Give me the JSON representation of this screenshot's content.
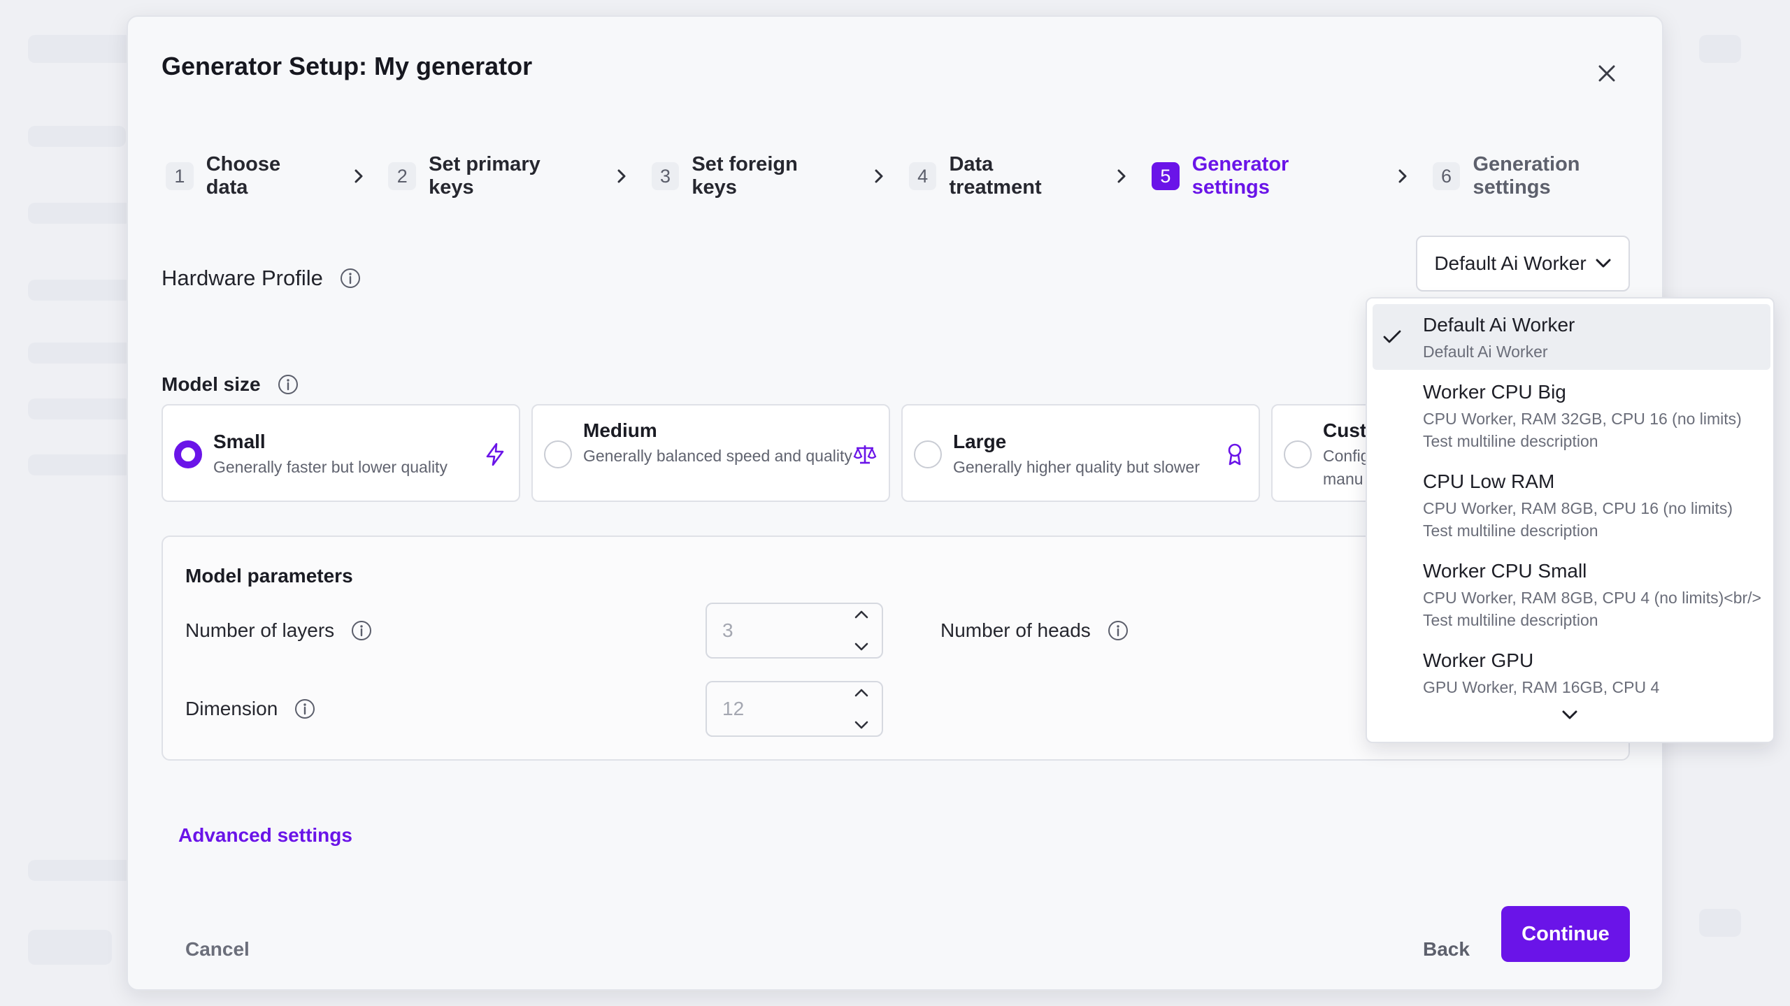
{
  "modal": {
    "title": "Generator Setup: My generator"
  },
  "stepper": [
    {
      "num": "1",
      "label": "Choose data"
    },
    {
      "num": "2",
      "label": "Set primary keys"
    },
    {
      "num": "3",
      "label": "Set foreign keys"
    },
    {
      "num": "4",
      "label": "Data treatment"
    },
    {
      "num": "5",
      "label": "Generator settings"
    },
    {
      "num": "6",
      "label": "Generation settings"
    }
  ],
  "hardware": {
    "label": "Hardware Profile",
    "selected": "Default Ai Worker"
  },
  "model_size": {
    "label": "Model size",
    "options": [
      {
        "title": "Small",
        "desc": "Generally faster but lower quality",
        "icon": "lightning-icon",
        "selected": true
      },
      {
        "title": "Medium",
        "desc": "Generally balanced speed and quality",
        "icon": "scale-icon",
        "selected": false
      },
      {
        "title": "Large",
        "desc": "Generally higher quality but slower",
        "icon": "award-icon",
        "selected": false
      },
      {
        "title": "Cust",
        "desc": "Config manu",
        "selected": false
      }
    ]
  },
  "params": {
    "title": "Model parameters",
    "layers_label": "Number of layers",
    "layers_value": "3",
    "heads_label": "Number of heads",
    "dimension_label": "Dimension",
    "dimension_value": "12"
  },
  "advanced_link": "Advanced settings",
  "footer": {
    "cancel": "Cancel",
    "back": "Back",
    "continue": "Continue"
  },
  "dropdown": {
    "options": [
      {
        "name": "Default Ai Worker",
        "line1": "Default Ai Worker",
        "line2": ""
      },
      {
        "name": "Worker CPU Big",
        "line1": "CPU Worker, RAM 32GB, CPU 16 (no limits)",
        "line2": "Test multiline description"
      },
      {
        "name": "CPU Low RAM",
        "line1": "CPU Worker, RAM 8GB, CPU 16 (no limits)",
        "line2": "Test multiline description"
      },
      {
        "name": "Worker CPU Small",
        "line1": "CPU Worker, RAM 8GB, CPU 4 (no limits)<br/>",
        "line2": "Test multiline description"
      },
      {
        "name": "Worker GPU",
        "line1": "GPU Worker, RAM 16GB, CPU 4",
        "line2": ""
      }
    ]
  },
  "colors": {
    "accent": "#6a14e8",
    "text": "#1a1b25",
    "muted": "#60636f"
  }
}
